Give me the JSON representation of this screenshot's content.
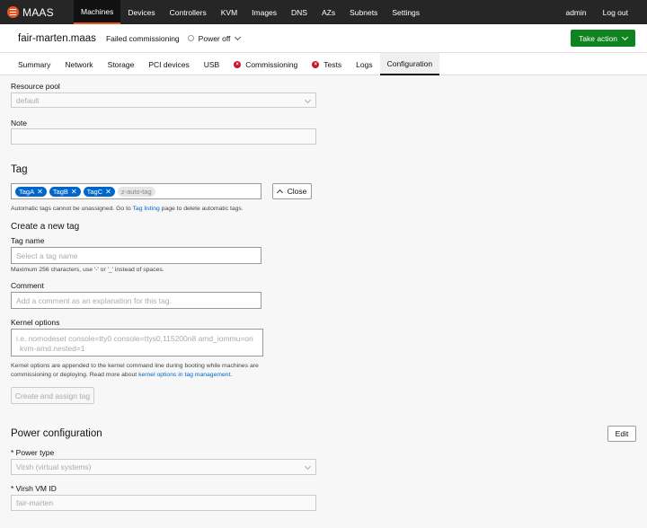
{
  "nav": {
    "brand": "MAAS",
    "items": [
      "Machines",
      "Devices",
      "Controllers",
      "KVM",
      "Images",
      "DNS",
      "AZs",
      "Subnets",
      "Settings"
    ],
    "user": "admin",
    "logout": "Log out"
  },
  "header": {
    "hostname": "fair-marten",
    "domain": ".maas",
    "status": "Failed commissioning",
    "power": "Power off",
    "take_action": "Take action"
  },
  "tabs": [
    "Summary",
    "Network",
    "Storage",
    "PCI devices",
    "USB",
    "Commissioning",
    "Tests",
    "Logs",
    "Configuration"
  ],
  "form": {
    "resource_pool_label": "Resource pool",
    "resource_pool_value": "default",
    "note_label": "Note",
    "tag_heading": "Tag",
    "tags": [
      "TagA",
      "TagB",
      "TagC"
    ],
    "auto_tag": "z-auto-tag",
    "close_label": "Close",
    "tag_help_pre": "Automatic tags cannot be unassigned. Go to ",
    "tag_help_link": "Tag listing",
    "tag_help_post": " page to delete automatic tags.",
    "create_tag_heading": "Create a new tag",
    "tag_name_label": "Tag name",
    "tag_name_placeholder": "Select a tag name",
    "tag_name_help": "Maximum 256 characters, use '-' or '_' instead of spaces.",
    "comment_label": "Comment",
    "comment_placeholder": "Add a comment as an explanation for this tag.",
    "kernel_label": "Kernel options",
    "kernel_placeholder_line1": "i.e. nomodeset console=tty0 console=ttys0,115200n8 amd_iommu=on",
    "kernel_placeholder_line2": "kvm-amd.nested=1",
    "kernel_help_line1": "Kernel options are appended to the kernel command line during booting while machines are",
    "kernel_help_line2_pre": "commissioning or deploying. Read more about ",
    "kernel_help_link": "kernel options in tag management",
    "kernel_help_line2_post": ".",
    "create_assign_label": "Create and assign tag"
  },
  "power": {
    "heading": "Power configuration",
    "edit_label": "Edit",
    "type_label": "* Power type",
    "type_value": "Virsh (virtual systems)",
    "vm_id_label": "* Virsh VM ID",
    "vm_id_value": "fair-marten"
  }
}
